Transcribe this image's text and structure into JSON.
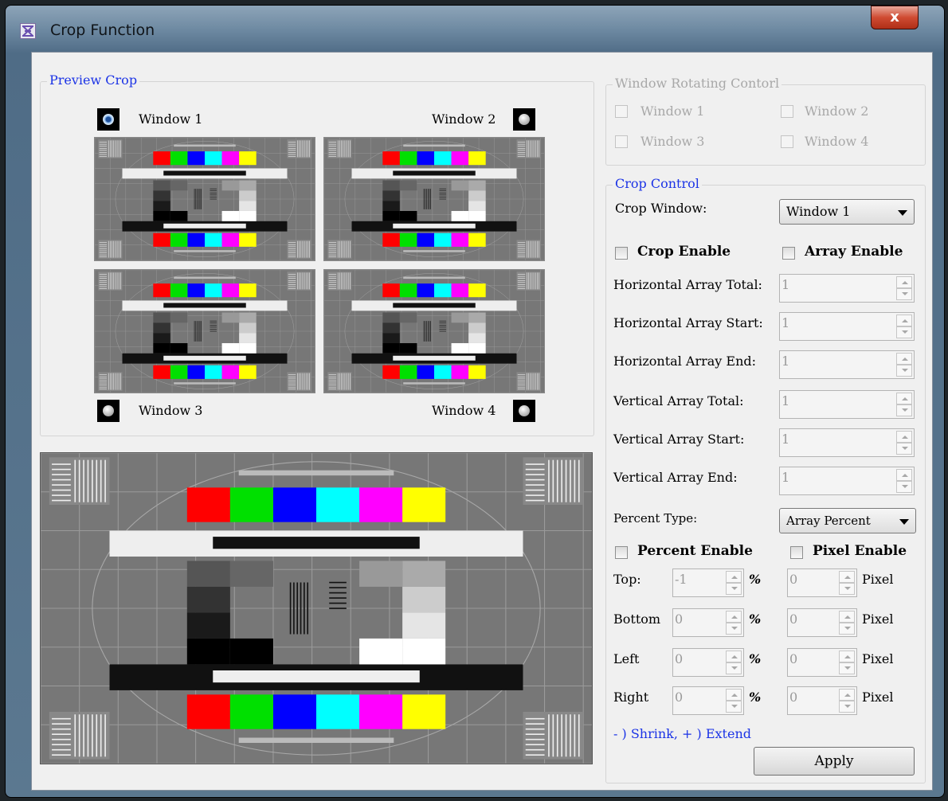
{
  "window": {
    "title": "Crop Function",
    "close_label": "x"
  },
  "preview": {
    "group_title": "Preview Crop",
    "windows": [
      "Window 1",
      "Window 2",
      "Window 3",
      "Window 4"
    ],
    "selected": "Window 1",
    "test_pattern_colors": [
      "#ff0000",
      "#00e000",
      "#0000ff",
      "#00ffff",
      "#ff00ff",
      "#ffff00"
    ]
  },
  "rotating": {
    "group_title": "Window Rotating Contorl",
    "items": [
      "Window 1",
      "Window 2",
      "Window 3",
      "Window 4"
    ]
  },
  "crop": {
    "group_title": "Crop Control",
    "crop_window_label": "Crop Window:",
    "crop_window_value": "Window 1",
    "crop_enable": "Crop Enable",
    "array_enable": "Array Enable",
    "fields": [
      {
        "label": "Horizontal Array Total:",
        "value": "1"
      },
      {
        "label": "Horizontal Array Start:",
        "value": "1"
      },
      {
        "label": "Horizontal Array End:",
        "value": "1"
      },
      {
        "label": "Vertical Array Total:",
        "value": "1"
      },
      {
        "label": "Vertical Array Start:",
        "value": "1"
      },
      {
        "label": "Vertical Array End:",
        "value": "1"
      }
    ],
    "percent_type_label": "Percent Type:",
    "percent_type_value": "Array Percent",
    "percent_enable": "Percent Enable",
    "pixel_enable": "Pixel Enable",
    "edges": [
      {
        "label": "Top:",
        "percent": "-1",
        "pixel": "0"
      },
      {
        "label": "Bottom",
        "percent": "0",
        "pixel": "0"
      },
      {
        "label": "Left",
        "percent": "0",
        "pixel": "0"
      },
      {
        "label": "Right",
        "percent": "0",
        "pixel": "0"
      }
    ],
    "percent_unit": "%",
    "pixel_unit": "Pixel",
    "hint": "- ) Shrink, + ) Extend",
    "apply_label": "Apply"
  }
}
